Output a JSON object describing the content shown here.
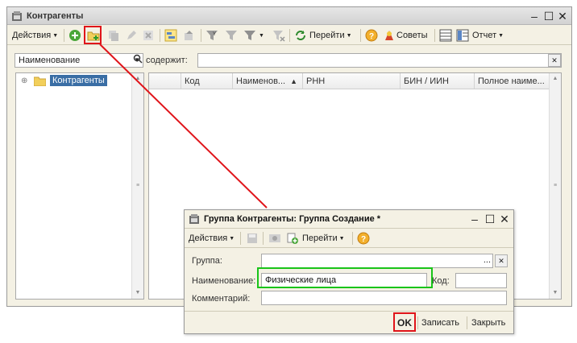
{
  "main": {
    "title": "Контрагенты",
    "toolbar": {
      "actions_label": "Действия",
      "goto_label": "Перейти",
      "tips_label": "Советы",
      "report_label": "Отчет"
    },
    "search": {
      "field_value": "Наименование",
      "contains_label": "содержит:",
      "query_value": ""
    },
    "tree": {
      "root_label": "Контрагенты"
    },
    "table": {
      "columns": [
        "Код",
        "Наименов...",
        "РНН",
        "БИН / ИИН",
        "Полное наиме..."
      ]
    }
  },
  "dialog": {
    "title": "Группа Контрагенты: Группа Создание *",
    "toolbar": {
      "actions_label": "Действия",
      "goto_label": "Перейти"
    },
    "form": {
      "group_label": "Группа:",
      "group_value": "",
      "name_label": "Наименование:",
      "name_value": "Физические лица",
      "code_label": "Код:",
      "code_value": "",
      "comment_label": "Комментарий:",
      "comment_value": ""
    },
    "buttons": {
      "ok": "OK",
      "save": "Записать",
      "close": "Закрыть"
    }
  },
  "colors": {
    "highlight_red": "#e0141a",
    "highlight_green": "#19c419",
    "selection": "#3a6ea5"
  }
}
